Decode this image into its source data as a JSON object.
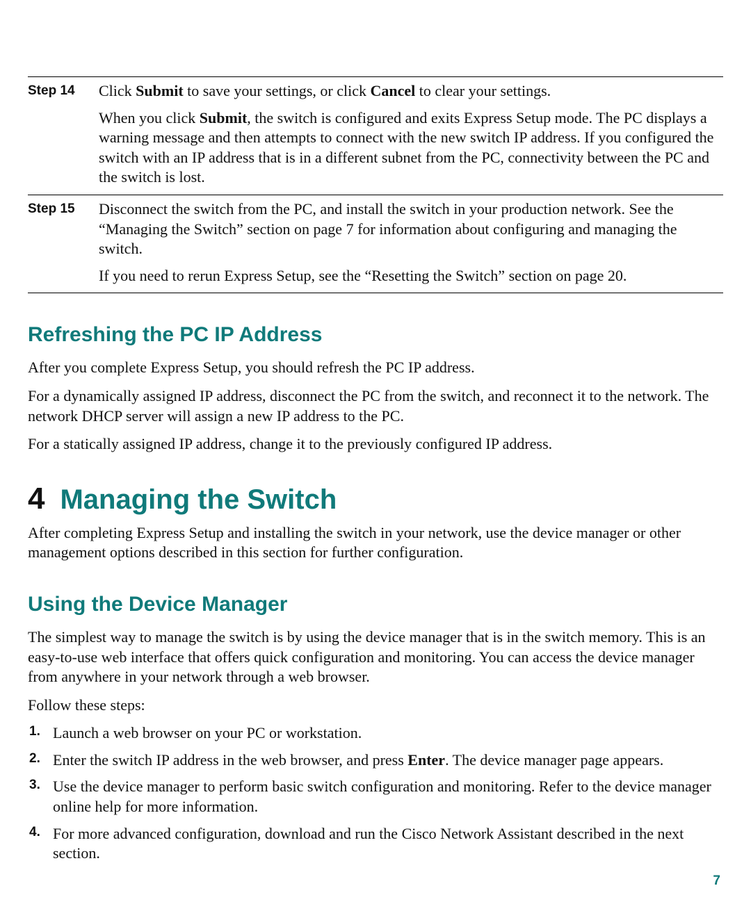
{
  "steps": [
    {
      "label": "Step 14",
      "para1_a": "Click ",
      "para1_b": "Submit",
      "para1_c": " to save your settings, or click ",
      "para1_d": "Cancel",
      "para1_e": " to clear your settings.",
      "para2_a": "When you click ",
      "para2_b": "Submit",
      "para2_c": ", the switch is configured and exits Express Setup mode. The PC displays a warning message and then attempts to connect with the new switch IP address. If you configured the switch with an IP address that is in a different subnet from the PC, connectivity between the PC and the switch is lost."
    },
    {
      "label": "Step 15",
      "para1": "Disconnect the switch from the PC, and install the switch in your production network. See the “Managing the Switch” section on page 7 for information about configuring and managing the switch.",
      "para2": "If you need to rerun Express Setup, see the “Resetting the Switch” section on page 20."
    }
  ],
  "section1": {
    "heading": "Refreshing the PC IP Address",
    "p1": "After you complete Express Setup, you should refresh the PC IP address.",
    "p2": "For a dynamically assigned IP address, disconnect the PC from the switch, and reconnect it to the network. The network DHCP server will assign a new IP address to the PC.",
    "p3": "For a statically assigned IP address, change it to the previously configured IP address."
  },
  "chapter": {
    "num": "4",
    "title": "Managing the Switch",
    "intro": "After completing Express Setup and installing the switch in your network, use the device manager or other management options described in this section for further configuration."
  },
  "section2": {
    "heading": "Using the Device Manager",
    "p1": "The simplest way to manage the switch is by using the device manager that is in the switch memory. This is an easy-to-use web interface that offers quick configuration and monitoring. You can access the device manager from anywhere in your network through a web browser.",
    "p2": "Follow these steps:",
    "list": [
      {
        "num": "1.",
        "text": "Launch a web browser on your PC or workstation."
      },
      {
        "num": "2.",
        "text_a": "Enter the switch IP address in the web browser, and press ",
        "text_b": "Enter",
        "text_c": ". The device manager page appears."
      },
      {
        "num": "3.",
        "text": "Use the device manager to perform basic switch configuration and monitoring. Refer to the device manager online help for more information."
      },
      {
        "num": "4.",
        "text": "For more advanced configuration, download and run the Cisco Network Assistant described in the next section."
      }
    ]
  },
  "page_number": "7"
}
